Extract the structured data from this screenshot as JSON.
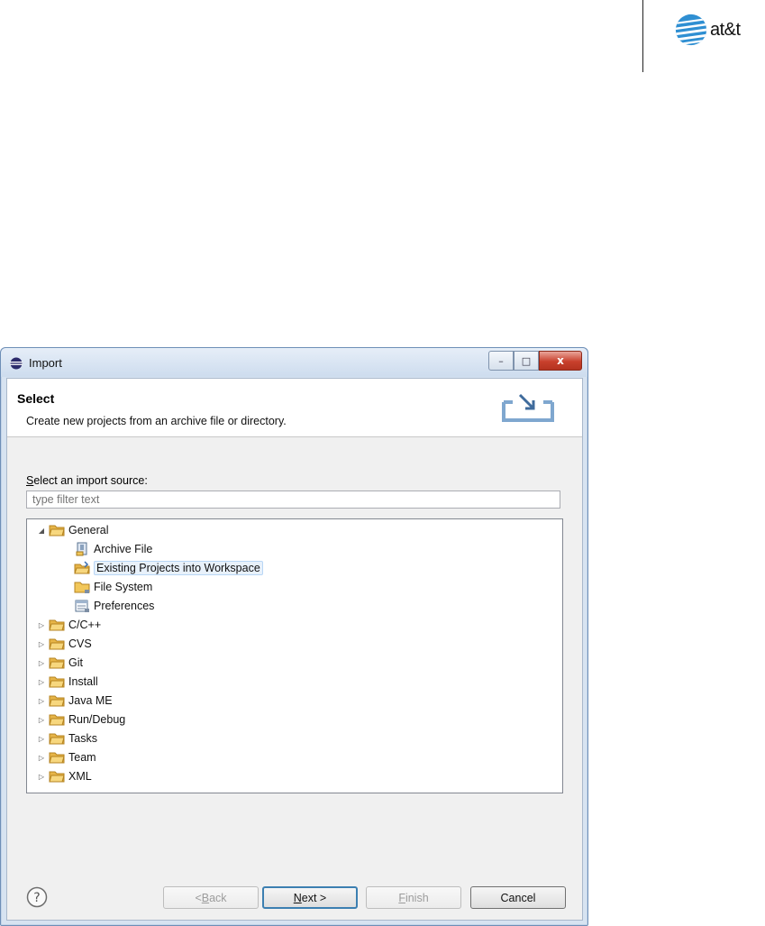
{
  "brand": {
    "logo_text": "at&t"
  },
  "window": {
    "title": "Import",
    "controls": {
      "minimize": "–",
      "maximize": "□",
      "close": "x"
    }
  },
  "banner": {
    "title": "Select",
    "description": "Create new projects from an archive file or directory."
  },
  "source": {
    "label_prefix": "S",
    "label_rest": "elect an import source:",
    "filter_placeholder": "type filter text"
  },
  "tree": {
    "root": "General",
    "children": [
      "Archive File",
      "Existing Projects into Workspace",
      "File System",
      "Preferences"
    ],
    "selected": "Existing Projects into Workspace",
    "categories": [
      "C/C++",
      "CVS",
      "Git",
      "Install",
      "Java ME",
      "Run/Debug",
      "Tasks",
      "Team",
      "XML"
    ]
  },
  "buttons": {
    "back": {
      "pre": "< ",
      "mn": "B",
      "post": "ack",
      "enabled": false
    },
    "next": {
      "pre": "",
      "mn": "N",
      "post": "ext >",
      "enabled": true
    },
    "finish": {
      "pre": "",
      "mn": "F",
      "post": "inish",
      "enabled": false
    },
    "cancel": {
      "label": "Cancel",
      "enabled": true
    }
  },
  "colors": {
    "window_frame": "#d7e3f1",
    "close_button": "#c8402c",
    "selection": "#e8f1fb",
    "folder": "#f2c75a"
  }
}
